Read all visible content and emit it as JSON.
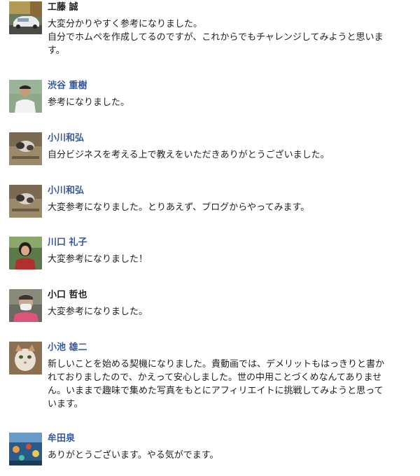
{
  "comments": [
    {
      "name": "工藤 誠",
      "lines": [
        "大変分かりやすく参考になりました。",
        "自分でホムペを作成してるのですが、これからでもチャレンジしてみようと思いま",
        "す。"
      ]
    },
    {
      "name": "渋谷 重樹",
      "lines": [
        "参考になりました。"
      ]
    },
    {
      "name": "小川和弘",
      "lines": [
        "自分ビジネスを考える上で教えをいただきありがとうございました。"
      ]
    },
    {
      "name": "小川和弘",
      "lines": [
        "大変参考になりました。とりあえず、ブログからやってみます。"
      ]
    },
    {
      "name": "川口 礼子",
      "lines": [
        "大変参考になりました！"
      ]
    },
    {
      "name": "小口 哲也",
      "lines": [
        "大変参考になりました。"
      ]
    },
    {
      "name": "小池 雄二",
      "lines": [
        "新しいことを始める契機になりました。貴動画では、デメリットもはっきりと書か",
        "れておりましたので、かえって安心しました。世の中用ことづくめなんてありませ",
        "ん。いままで趣味で集めた写真をもとにアフィリエイトに挑戦してみようと思って",
        "います。"
      ]
    },
    {
      "name": "牟田泉",
      "lines": [
        "ありがとうございます。やる気がでます。"
      ]
    }
  ]
}
